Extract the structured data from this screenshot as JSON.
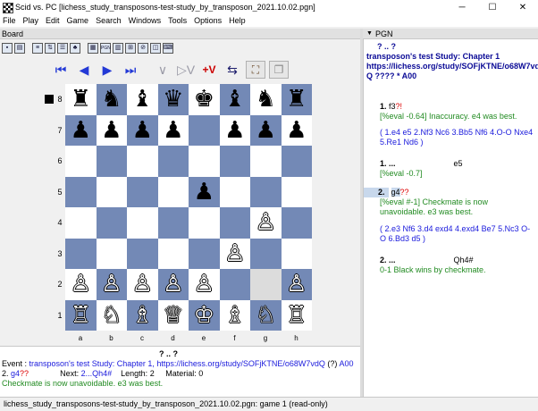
{
  "window": {
    "title": "Scid vs. PC [lichess_study_transposons-test-study_by_transposon_2021.10.02.pgn]",
    "minimize": "─",
    "maximize": "☐",
    "close": "✕"
  },
  "menu": [
    "File",
    "Play",
    "Edit",
    "Game",
    "Search",
    "Windows",
    "Tools",
    "Options",
    "Help"
  ],
  "board_panel": {
    "title": "Board"
  },
  "pgn_panel": {
    "arrow": "▼",
    "title": "PGN"
  },
  "toolbar": {
    "icons": [
      "save-icon",
      "print-icon",
      "layout-icon",
      "flip-icon",
      "pgn-icon",
      "tree-icon",
      "stats-icon",
      "comment-icon",
      "book-icon",
      "engine-icon",
      "no-icon",
      "computer-icon"
    ]
  },
  "nav": {
    "first": "⏮",
    "back": "◀",
    "forward": "▶",
    "last": "⏭",
    "var_back": "∨",
    "var_fwd": "▷V",
    "add_var": "+V",
    "flip": "⇆",
    "setup": "⛶",
    "copy": "❐"
  },
  "board": {
    "side_to_move": "black",
    "ranks": [
      "8",
      "7",
      "6",
      "5",
      "4",
      "3",
      "2",
      "1"
    ],
    "files": [
      "a",
      "b",
      "c",
      "d",
      "e",
      "f",
      "g",
      "h"
    ],
    "rows": [
      [
        "♜",
        "♞",
        "♝",
        "♛",
        "♚",
        "♝",
        "♞",
        "♜"
      ],
      [
        "♟",
        "♟",
        "♟",
        "♟",
        "",
        "♟",
        "♟",
        "♟"
      ],
      [
        "",
        "",
        "",
        "",
        "",
        "",
        "",
        ""
      ],
      [
        "",
        "",
        "",
        "",
        "♟",
        "",
        "",
        ""
      ],
      [
        "",
        "",
        "",
        "",
        "",
        "",
        "♙",
        ""
      ],
      [
        "",
        "",
        "",
        "",
        "",
        "♙",
        "",
        ""
      ],
      [
        "♙",
        "♙",
        "♙",
        "♙",
        "♙",
        "",
        "",
        "♙"
      ],
      [
        "♖",
        "♘",
        "♗",
        "♕",
        "♔",
        "♗",
        "♘",
        "♖"
      ]
    ],
    "highlight": [
      [
        6,
        6
      ]
    ]
  },
  "info": {
    "line1_prefix": "?  ..  ?",
    "event_label": "Event :",
    "event_text": "transposon's test Study: Chapter 1, https://lichess.org/study/SOFjKTNE/o68W7vdQ",
    "event_suffix": "(?)",
    "eco": "A00",
    "move_no": "2.",
    "move": "g4",
    "move_nag": "??",
    "next_label": "Next:",
    "next_move": "2...Qh4#",
    "length_label": "Length:",
    "length": "2",
    "material_label": "Material:",
    "material": "0",
    "comment": "Checkmate is now unavoidable. e3 was best."
  },
  "pgn": {
    "header_line1": "?  ..  ?",
    "header_line2": "transposon's test Study: Chapter 1",
    "header_line3": "https://lichess.org/study/SOFjKTNE/o68W7vd",
    "header_line4": "Q  ????  *  A00",
    "m1_num": "1.",
    "m1_move": "f3",
    "m1_nag": "?!",
    "m1_comment": "[%eval -0.64] Inaccuracy. e4 was best.",
    "m1_variation": "( 1.e4 e5 2.Nf3 Nc6 3.Bb5 Nf6 4.O-O Nxe4 5.Re1 Nd6 )",
    "m1b_num": "1.  ...",
    "m1b_move": "e5",
    "m1b_comment": "[%eval -0.7]",
    "m2_num": "2.",
    "m2_move": "g4",
    "m2_nag": "??",
    "m2_comment": "[%eval #-1] Checkmate is now unavoidable. e3 was best.",
    "m2_variation": "( 2.e3 Nf6 3.d4 exd4 4.exd4 Be7 5.Nc3 O-O 6.Bd3 d5 )",
    "m2b_num": "2.  ...",
    "m2b_move": "Qh4#",
    "result": "0-1 Black wins by checkmate."
  },
  "status": "lichess_study_transposons-test-study_by_transposon_2021.10.02.pgn:  game 1    (read-only)"
}
